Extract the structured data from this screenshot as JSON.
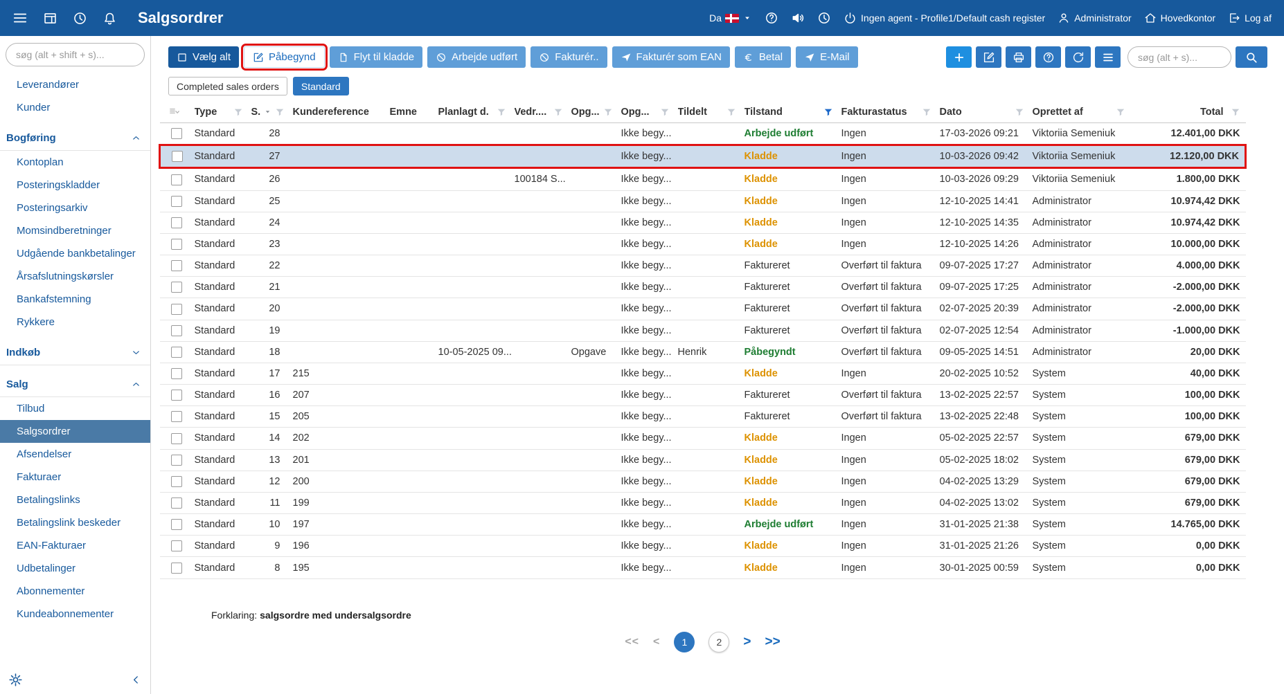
{
  "colors": {
    "topbar": "#17599c",
    "accent": "#2d76c0",
    "button-light": "#5f9ed8",
    "button-plus": "#1e8fe0",
    "status-green": "#1e7d32",
    "status-orange": "#dd9200",
    "annotation": "#e01212",
    "selected-row": "#cddcec",
    "link": "#17599c"
  },
  "topbar": {
    "title": "Salgsordrer",
    "lang": "Da",
    "agent_text": "Ingen agent - Profile1/Default cash register",
    "user": "Administrator",
    "office": "Hovedkontor",
    "logout": "Log af"
  },
  "sidebar": {
    "search_placeholder": "søg (alt + shift + s)...",
    "top_items": [
      "Leverandører",
      "Kunder"
    ],
    "sections": [
      {
        "label": "Bogføring",
        "expanded": true,
        "items": [
          "Kontoplan",
          "Posteringskladder",
          "Posteringsarkiv",
          "Momsindberetninger",
          "Udgående bankbetalinger",
          "Årsafslutningskørsler",
          "Bankafstemning",
          "Rykkere"
        ]
      },
      {
        "label": "Indkøb",
        "expanded": false,
        "items": []
      },
      {
        "label": "Salg",
        "expanded": true,
        "active_item": "Salgsordrer",
        "items": [
          "Tilbud",
          "Salgsordrer",
          "Afsendelser",
          "Fakturaer",
          "Betalingslinks",
          "Betalingslink beskeder",
          "EAN-Fakturaer",
          "Udbetalinger",
          "Abonnementer",
          "Kundeabonnementer"
        ]
      }
    ]
  },
  "toolbar": {
    "buttons": [
      {
        "label": "Vælg alt",
        "icon": "square",
        "style": "dark",
        "annotated": false
      },
      {
        "label": "Påbegynd",
        "icon": "editbox",
        "style": "white",
        "annotated": true
      },
      {
        "label": "Flyt til kladde",
        "icon": "page",
        "style": "mid",
        "annotated": false
      },
      {
        "label": "Arbejde udført",
        "icon": "slashcircle",
        "style": "mid",
        "annotated": false
      },
      {
        "label": "Fakturér..",
        "icon": "slashcircle",
        "style": "mid",
        "annotated": false
      },
      {
        "label": "Fakturér som EAN",
        "icon": "plane",
        "style": "mid",
        "annotated": false
      },
      {
        "label": "Betal",
        "icon": "euro",
        "style": "mid",
        "annotated": false
      },
      {
        "label": "E-Mail",
        "icon": "send",
        "style": "mid",
        "annotated": false
      }
    ],
    "icon_buttons": [
      "plus",
      "editbox",
      "print",
      "help",
      "refresh",
      "list"
    ],
    "search_placeholder": "søg (alt + s)..."
  },
  "filters": {
    "chips": [
      {
        "label": "Completed sales orders",
        "active": false
      },
      {
        "label": "Standard",
        "active": true
      }
    ]
  },
  "table": {
    "columns": [
      {
        "label": "",
        "select": true
      },
      {
        "label": "Type",
        "funnel": true
      },
      {
        "label": "S.",
        "funnel": true,
        "sort": true
      },
      {
        "label": "Kundereference"
      },
      {
        "label": "Emne"
      },
      {
        "label": "Planlagt d.",
        "funnel": true
      },
      {
        "label": "Vedr....",
        "funnel": true
      },
      {
        "label": "Opg...",
        "funnel": true
      },
      {
        "label": "Opg...",
        "funnel": true
      },
      {
        "label": "Tildelt",
        "funnel": true
      },
      {
        "label": "Tilstand",
        "funnel": true,
        "funnel_active": true
      },
      {
        "label": "Fakturastatus",
        "funnel": true
      },
      {
        "label": "Dato",
        "funnel": true
      },
      {
        "label": "Oprettet af",
        "funnel": true
      },
      {
        "label": "Total",
        "funnel": true,
        "align": "right"
      }
    ],
    "rows": [
      {
        "type": "Standard",
        "s": "28",
        "task_status": "Ikke begy...",
        "state": "Arbejde udført",
        "state_color": "green",
        "invoice_status": "Ingen",
        "date": "17-03-2026 09:21",
        "created_by": "Viktoriia Semeniuk",
        "total": "12.401,00 DKK"
      },
      {
        "type": "Standard",
        "s": "27",
        "task_status": "Ikke begy...",
        "state": "Kladde",
        "state_color": "orange",
        "invoice_status": "Ingen",
        "date": "10-03-2026 09:42",
        "created_by": "Viktoriia Semeniuk",
        "total": "12.120,00 DKK",
        "selected": true
      },
      {
        "type": "Standard",
        "s": "26",
        "regarding": "100184 S...",
        "task_status": "Ikke begy...",
        "state": "Kladde",
        "state_color": "orange",
        "invoice_status": "Ingen",
        "date": "10-03-2026 09:29",
        "created_by": "Viktoriia Semeniuk",
        "total": "1.800,00 DKK"
      },
      {
        "type": "Standard",
        "s": "25",
        "task_status": "Ikke begy...",
        "state": "Kladde",
        "state_color": "orange",
        "invoice_status": "Ingen",
        "date": "12-10-2025 14:41",
        "created_by": "Administrator",
        "total": "10.974,42 DKK"
      },
      {
        "type": "Standard",
        "s": "24",
        "task_status": "Ikke begy...",
        "state": "Kladde",
        "state_color": "orange",
        "invoice_status": "Ingen",
        "date": "12-10-2025 14:35",
        "created_by": "Administrator",
        "total": "10.974,42 DKK"
      },
      {
        "type": "Standard",
        "s": "23",
        "task_status": "Ikke begy...",
        "state": "Kladde",
        "state_color": "orange",
        "invoice_status": "Ingen",
        "date": "12-10-2025 14:26",
        "created_by": "Administrator",
        "total": "10.000,00 DKK"
      },
      {
        "type": "Standard",
        "s": "22",
        "task_status": "Ikke begy...",
        "state": "Faktureret",
        "invoice_status": "Overført til faktura",
        "date": "09-07-2025 17:27",
        "created_by": "Administrator",
        "total": "4.000,00 DKK"
      },
      {
        "type": "Standard",
        "s": "21",
        "task_status": "Ikke begy...",
        "state": "Faktureret",
        "invoice_status": "Overført til faktura",
        "date": "09-07-2025 17:25",
        "created_by": "Administrator",
        "total": "-2.000,00 DKK"
      },
      {
        "type": "Standard",
        "s": "20",
        "task_status": "Ikke begy...",
        "state": "Faktureret",
        "invoice_status": "Overført til faktura",
        "date": "02-07-2025 20:39",
        "created_by": "Administrator",
        "total": "-2.000,00 DKK"
      },
      {
        "type": "Standard",
        "s": "19",
        "task_status": "Ikke begy...",
        "state": "Faktureret",
        "invoice_status": "Overført til faktura",
        "date": "02-07-2025 12:54",
        "created_by": "Administrator",
        "total": "-1.000,00 DKK"
      },
      {
        "type": "Standard",
        "s": "18",
        "planned": "10-05-2025 09...",
        "task": "Opgave",
        "task_status": "Ikke begy...",
        "assigned": "Henrik",
        "state": "Påbegyndt",
        "state_color": "green",
        "invoice_status": "Overført til faktura",
        "date": "09-05-2025 14:51",
        "created_by": "Administrator",
        "total": "20,00 DKK"
      },
      {
        "type": "Standard",
        "s": "17",
        "ref": "215",
        "task_status": "Ikke begy...",
        "state": "Kladde",
        "state_color": "orange",
        "invoice_status": "Ingen",
        "date": "20-02-2025 10:52",
        "created_by": "System",
        "total": "40,00 DKK"
      },
      {
        "type": "Standard",
        "s": "16",
        "ref": "207",
        "task_status": "Ikke begy...",
        "state": "Faktureret",
        "invoice_status": "Overført til faktura",
        "date": "13-02-2025 22:57",
        "created_by": "System",
        "total": "100,00 DKK"
      },
      {
        "type": "Standard",
        "s": "15",
        "ref": "205",
        "task_status": "Ikke begy...",
        "state": "Faktureret",
        "invoice_status": "Overført til faktura",
        "date": "13-02-2025 22:48",
        "created_by": "System",
        "total": "100,00 DKK"
      },
      {
        "type": "Standard",
        "s": "14",
        "ref": "202",
        "task_status": "Ikke begy...",
        "state": "Kladde",
        "state_color": "orange",
        "invoice_status": "Ingen",
        "date": "05-02-2025 22:57",
        "created_by": "System",
        "total": "679,00 DKK"
      },
      {
        "type": "Standard",
        "s": "13",
        "ref": "201",
        "task_status": "Ikke begy...",
        "state": "Kladde",
        "state_color": "orange",
        "invoice_status": "Ingen",
        "date": "05-02-2025 18:02",
        "created_by": "System",
        "total": "679,00 DKK"
      },
      {
        "type": "Standard",
        "s": "12",
        "ref": "200",
        "task_status": "Ikke begy...",
        "state": "Kladde",
        "state_color": "orange",
        "invoice_status": "Ingen",
        "date": "04-02-2025 13:29",
        "created_by": "System",
        "total": "679,00 DKK"
      },
      {
        "type": "Standard",
        "s": "11",
        "ref": "199",
        "task_status": "Ikke begy...",
        "state": "Kladde",
        "state_color": "orange",
        "invoice_status": "Ingen",
        "date": "04-02-2025 13:02",
        "created_by": "System",
        "total": "679,00 DKK"
      },
      {
        "type": "Standard",
        "s": "10",
        "ref": "197",
        "task_status": "Ikke begy...",
        "state": "Arbejde udført",
        "state_color": "green",
        "invoice_status": "Ingen",
        "date": "31-01-2025 21:38",
        "created_by": "System",
        "total": "14.765,00 DKK"
      },
      {
        "type": "Standard",
        "s": "9",
        "ref": "196",
        "task_status": "Ikke begy...",
        "state": "Kladde",
        "state_color": "orange",
        "invoice_status": "Ingen",
        "date": "31-01-2025 21:26",
        "created_by": "System",
        "total": "0,00 DKK"
      },
      {
        "type": "Standard",
        "s": "8",
        "ref": "195",
        "task_status": "Ikke begy...",
        "state": "Kladde",
        "state_color": "orange",
        "invoice_status": "Ingen",
        "date": "30-01-2025 00:59",
        "created_by": "System",
        "total": "0,00 DKK"
      }
    ]
  },
  "footer": {
    "legend_label": "Forklaring:",
    "legend_text": "salgsordre med undersalgsordre",
    "pagination": [
      {
        "label": "<<",
        "kind": "nav-muted"
      },
      {
        "label": "<",
        "kind": "nav-muted"
      },
      {
        "label": "1",
        "kind": "page-active"
      },
      {
        "label": "2",
        "kind": "page"
      },
      {
        "label": ">",
        "kind": "nav-blue"
      },
      {
        "label": ">>",
        "kind": "nav-blue"
      }
    ]
  }
}
